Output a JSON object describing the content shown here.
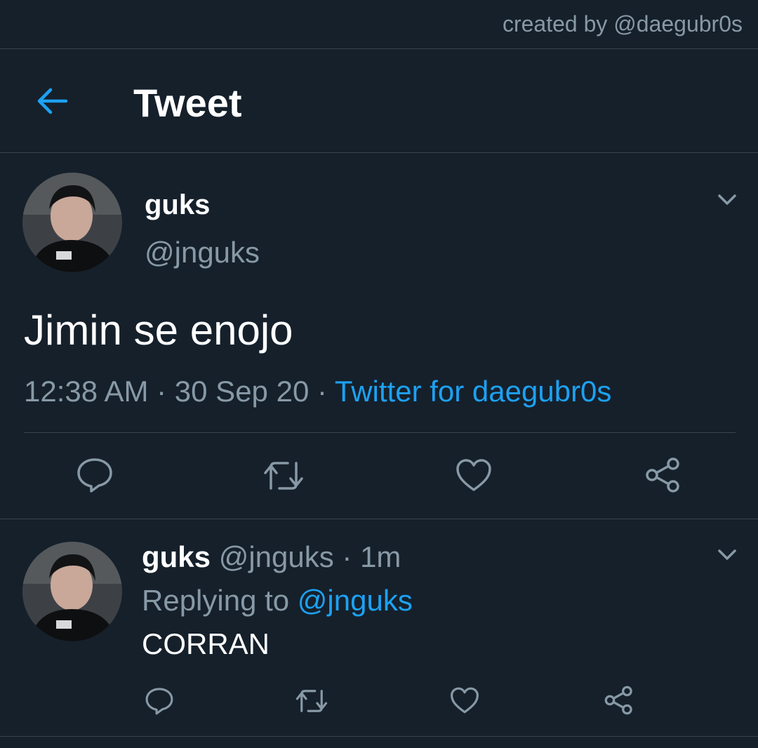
{
  "credit": "created by @daegubr0s",
  "header": {
    "title": "Tweet"
  },
  "main_tweet": {
    "name": "guks",
    "handle": "@jnguks",
    "text": "Jimin se enojo",
    "time": "12:38 AM",
    "sep1": " · ",
    "date": "30 Sep 20",
    "sep2": " · ",
    "source": "Twitter for daegubr0s"
  },
  "reply_tweet": {
    "name": "guks",
    "handle": "@jnguks",
    "sep": " · ",
    "age": "1m",
    "replying_prefix": "Replying to ",
    "replying_handle": "@jnguks",
    "text": "CORRAN"
  },
  "icons": {
    "back": "arrow-left-icon",
    "chevron": "chevron-down-icon",
    "reply": "comment-bubble-icon",
    "retweet": "retweet-icon",
    "like": "heart-icon",
    "share": "share-icon"
  },
  "colors": {
    "background": "#15202b",
    "accent": "#1da1f2",
    "secondary_text": "#8899a6",
    "divider": "#38444d"
  }
}
